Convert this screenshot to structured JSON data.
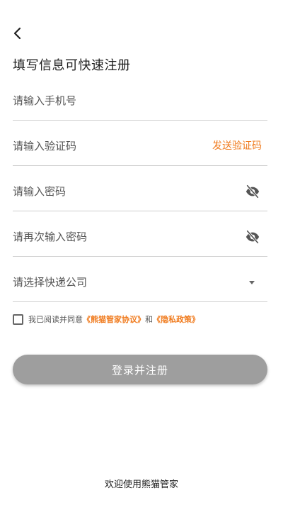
{
  "header": {
    "title": "填写信息可快速注册"
  },
  "form": {
    "phone_placeholder": "请输入手机号",
    "code_placeholder": "请输入验证码",
    "send_code_label": "发送验证码",
    "password_placeholder": "请输入密码",
    "confirm_password_placeholder": "请再次输入密码",
    "courier_placeholder": "请选择快递公司"
  },
  "agreement": {
    "prefix": "我已阅读并同意",
    "terms_link": "《熊猫管家协议》",
    "conjunction": "和",
    "privacy_link": "《隐私政策》"
  },
  "submit": {
    "label": "登录并注册"
  },
  "footer": {
    "text": "欢迎使用熊猫管家"
  },
  "colors": {
    "accent": "#f07b1e",
    "button_disabled": "#9e9e9e",
    "divider": "#cfcfcf"
  }
}
